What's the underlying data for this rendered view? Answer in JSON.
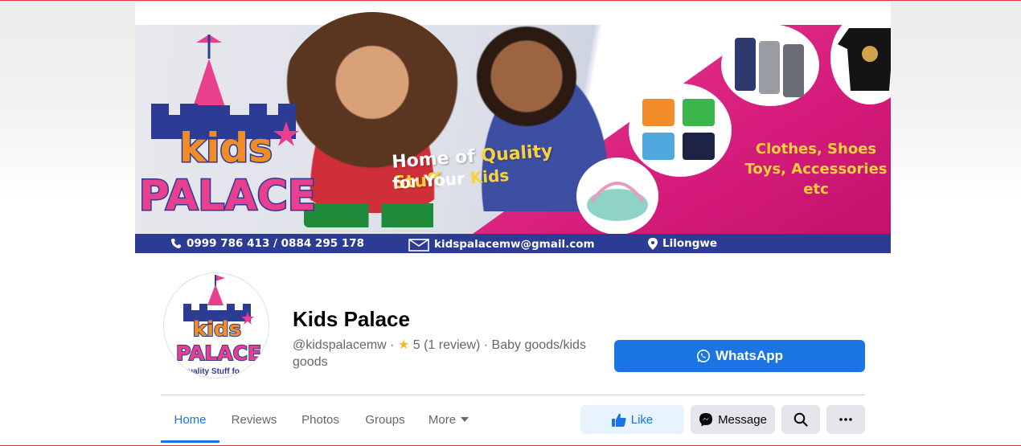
{
  "cover": {
    "tagline_part1": "Home of ",
    "tagline_highlight1": "Quality Stuff",
    "tagline_part2": "for Your ",
    "tagline_highlight2": "Kids",
    "products_line1": "Clothes, Shoes",
    "products_line2": "Toys, Accessories",
    "products_line3": "etc",
    "phone": "0999 786 413 / 0884 295 178",
    "email": "kidspalacemw@gmail.com",
    "location": "Lilongwe",
    "logo_line1": "kids",
    "logo_line2": "PALACE"
  },
  "avatar": {
    "logo_line1": "kids",
    "logo_line2": "PALACE",
    "caption": "uality Stuff fo"
  },
  "profile": {
    "name": "Kids Palace",
    "handle": "@kidspalacemw",
    "separator": " · ",
    "rating": "5 (1 review)",
    "category": "Baby goods/kids goods"
  },
  "whatsapp": {
    "label": "WhatsApp"
  },
  "tabs": [
    {
      "label": "Home",
      "active": true
    },
    {
      "label": "Reviews"
    },
    {
      "label": "Photos"
    },
    {
      "label": "Groups"
    },
    {
      "label": "More"
    }
  ],
  "actions": {
    "like": "Like",
    "message": "Message"
  },
  "colors": {
    "accent": "#1b74e4",
    "cover_pink": "#d61c7c",
    "cover_blue_bar": "#2c3c94",
    "highlight_yellow": "#f7d23c"
  },
  "icons": [
    "phone-icon",
    "mail-icon",
    "location-pin-icon",
    "star-icon",
    "whatsapp-icon",
    "thumbs-up-icon",
    "messenger-icon",
    "search-icon",
    "ellipsis-icon",
    "caret-down-icon"
  ]
}
